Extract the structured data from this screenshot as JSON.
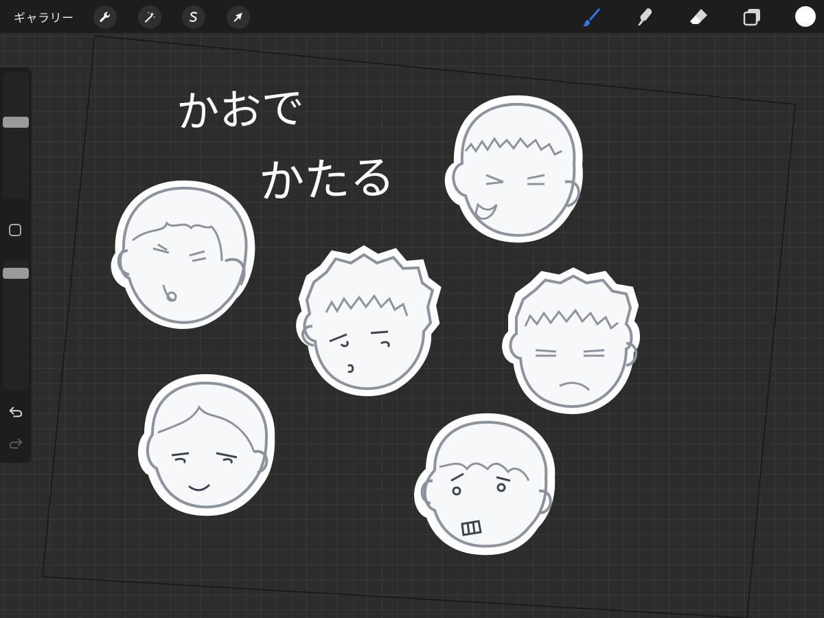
{
  "topbar": {
    "gallery_label": "ギャラリー",
    "left_tools": [
      {
        "name": "actions",
        "icon": "wrench-icon"
      },
      {
        "name": "adjustments",
        "icon": "magic-wand-icon"
      },
      {
        "name": "selection",
        "icon": "selection-s-icon"
      },
      {
        "name": "transform",
        "icon": "arrow-cursor-icon"
      }
    ],
    "right_tools": [
      {
        "name": "brush",
        "icon": "brush-icon",
        "active": true
      },
      {
        "name": "smudge",
        "icon": "smudge-icon",
        "active": false
      },
      {
        "name": "eraser",
        "icon": "eraser-icon",
        "active": false
      },
      {
        "name": "layers",
        "icon": "layers-icon",
        "active": false
      }
    ],
    "current_color": "#ffffff"
  },
  "sidebar": {
    "brush_size_level": 0.62,
    "opacity_level": 0.93,
    "modify_icon": "square-icon",
    "undo_icon": "undo-icon",
    "redo_icon": "redo-icon"
  },
  "canvas": {
    "title_line1": "かおで",
    "title_line2": "かたる",
    "stroke_color": "#ffffff",
    "face_fill": "#f7f8fa",
    "face_outline": "#8a939e",
    "face_count": 6
  },
  "colors": {
    "accent": "#2d7cf6",
    "toolbar_bg": "#1d1d1e",
    "canvas_bg": "#2c2c2d"
  }
}
